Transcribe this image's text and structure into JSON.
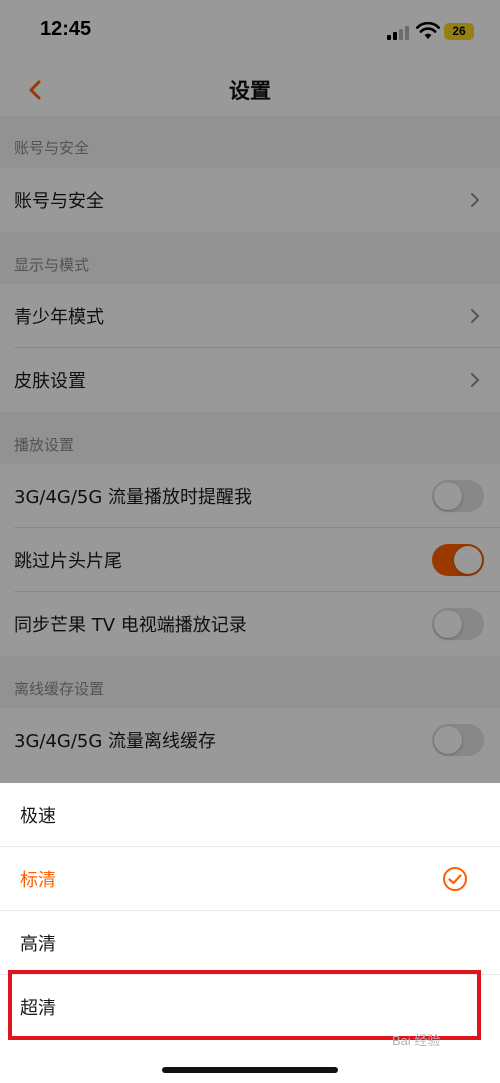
{
  "status_bar": {
    "time": "12:45",
    "battery": "26"
  },
  "nav": {
    "title": "设置",
    "back_icon": "chevron-left-icon"
  },
  "colors": {
    "accent": "#ff5f00",
    "highlight": "#e0141c"
  },
  "sections": [
    {
      "header": "账号与安全",
      "rows": [
        {
          "label": "账号与安全",
          "type": "chevron"
        }
      ]
    },
    {
      "header": "显示与模式",
      "rows": [
        {
          "label": "青少年模式",
          "type": "chevron"
        },
        {
          "label": "皮肤设置",
          "type": "chevron"
        }
      ]
    },
    {
      "header": "播放设置",
      "rows": [
        {
          "label": "3G/4G/5G 流量播放时提醒我",
          "type": "toggle",
          "on": false
        },
        {
          "label": "跳过片头片尾",
          "type": "toggle",
          "on": true
        },
        {
          "label": "同步芒果 TV 电视端播放记录",
          "type": "toggle",
          "on": false
        }
      ]
    },
    {
      "header": "离线缓存设置",
      "rows": [
        {
          "label": "3G/4G/5G 流量离线缓存",
          "type": "toggle",
          "on": false
        }
      ]
    }
  ],
  "quality_sheet": {
    "options": [
      {
        "label": "极速",
        "selected": false
      },
      {
        "label": "标清",
        "selected": true
      },
      {
        "label": "高清",
        "selected": false
      },
      {
        "label": "超清",
        "selected": false
      }
    ]
  },
  "watermark": "Bai 经验"
}
